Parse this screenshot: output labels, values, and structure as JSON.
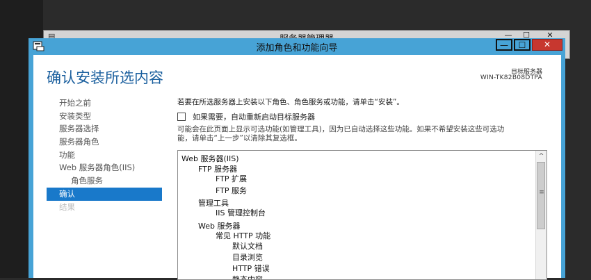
{
  "background_window": {
    "title": "服务器管理器",
    "min": "—",
    "max": "☐",
    "close": "✕"
  },
  "window": {
    "title": "添加角色和功能向导",
    "min_label": "—",
    "max_label": "☐",
    "close_label": "✕"
  },
  "page": {
    "heading": "确认安装所选内容",
    "server_label": "目标服务器",
    "server_name": "WIN-TK82B08DTPA"
  },
  "nav": {
    "items": [
      {
        "label": "开始之前",
        "state": "normal"
      },
      {
        "label": "安装类型",
        "state": "normal"
      },
      {
        "label": "服务器选择",
        "state": "normal"
      },
      {
        "label": "服务器角色",
        "state": "normal"
      },
      {
        "label": "功能",
        "state": "normal"
      },
      {
        "label": "Web 服务器角色(IIS)",
        "state": "normal"
      },
      {
        "label": "角色服务",
        "state": "sub"
      },
      {
        "label": "确认",
        "state": "active"
      },
      {
        "label": "结果",
        "state": "disabled"
      }
    ]
  },
  "main": {
    "intro": "若要在所选服务器上安装以下角色、角色服务或功能，请单击“安装”。",
    "restart_label": "如果需要，自动重新启动目标服务器",
    "restart_checked": false,
    "note_line1": "可能会在此页面上显示可选功能(如管理工具)，因为已自动选择这些功能。如果不希望安装这些可选功",
    "note_line2": "能，请单击“上一步”以清除其复选框。"
  },
  "feature_list": [
    {
      "text": "Web 服务器(IIS)",
      "level": 0
    },
    {
      "text": "FTP 服务器",
      "level": 1
    },
    {
      "text": "FTP 扩展",
      "level": 2
    },
    {
      "text": "FTP 服务",
      "level": 2
    },
    {
      "text": "管理工具",
      "level": 1
    },
    {
      "text": "IIS 管理控制台",
      "level": 2
    },
    {
      "text": "Web 服务器",
      "level": 1
    },
    {
      "text": "常见 HTTP 功能",
      "level": 2
    },
    {
      "text": "默认文档",
      "level": 3
    },
    {
      "text": "目录浏览",
      "level": 3
    },
    {
      "text": "HTTP 错误",
      "level": 3
    },
    {
      "text": "静态内容",
      "level": 3
    }
  ],
  "scrollbar": {
    "up": "^",
    "grip": "≡"
  },
  "colors": {
    "accent": "#47a3d6",
    "heading": "#1a5f9e",
    "nav_active": "#1979ca",
    "close": "#c7372f"
  }
}
